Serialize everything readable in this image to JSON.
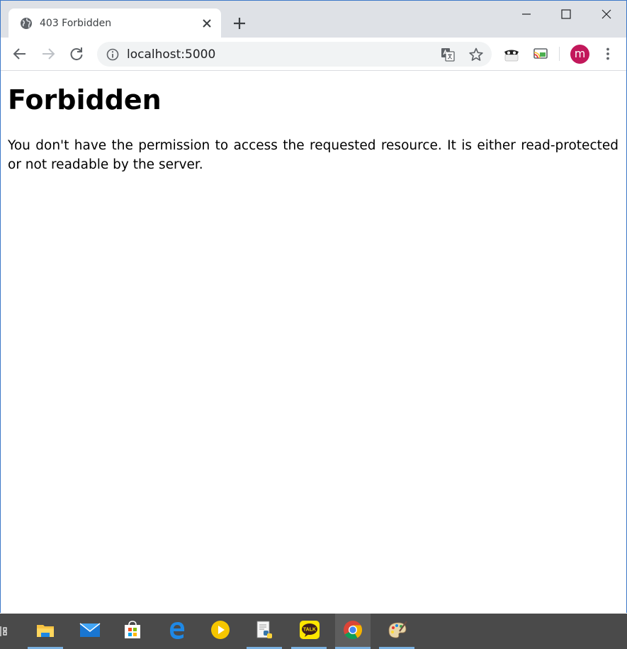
{
  "browser": {
    "tab": {
      "title": "403 Forbidden"
    },
    "address": {
      "url": "localhost:5000"
    },
    "profile": {
      "initial": "m",
      "color": "#c2185b"
    }
  },
  "page": {
    "heading": "Forbidden",
    "message": "You don't have the permission to access the requested resource. It is either read-protected or not readable by the server."
  },
  "taskbar": {
    "items": [
      {
        "name": "file-explorer-icon"
      },
      {
        "name": "mail-icon"
      },
      {
        "name": "store-icon"
      },
      {
        "name": "edge-icon"
      },
      {
        "name": "media-player-icon"
      },
      {
        "name": "python-editor-icon"
      },
      {
        "name": "kakaotalk-icon",
        "label": "TALK"
      },
      {
        "name": "chrome-icon"
      },
      {
        "name": "paint-icon"
      }
    ]
  }
}
